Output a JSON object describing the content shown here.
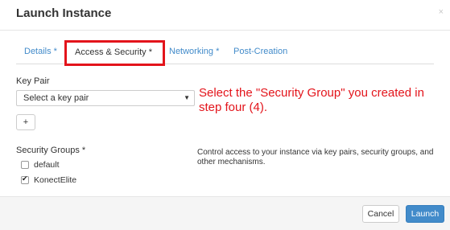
{
  "modal": {
    "title": "Launch Instance",
    "close_label": "×"
  },
  "tabs": [
    {
      "label": "Details *"
    },
    {
      "label": "Access & Security *",
      "active": true
    },
    {
      "label": "Networking *"
    },
    {
      "label": "Post-Creation"
    }
  ],
  "key_pair": {
    "label": "Key Pair",
    "selected": "Select a key pair",
    "add_label": "+"
  },
  "annotation": "Select the \"Security Group\" you created in step four (4).",
  "security_groups": {
    "label": "Security Groups *",
    "options": [
      {
        "label": "default",
        "checked": false
      },
      {
        "label": "KonectElite",
        "checked": true
      }
    ]
  },
  "help_text": "Control access to your instance via key pairs, security groups, and other mechanisms.",
  "footer": {
    "cancel_label": "Cancel",
    "launch_label": "Launch"
  },
  "colors": {
    "accent": "#428bca",
    "highlight": "#e3141b"
  }
}
